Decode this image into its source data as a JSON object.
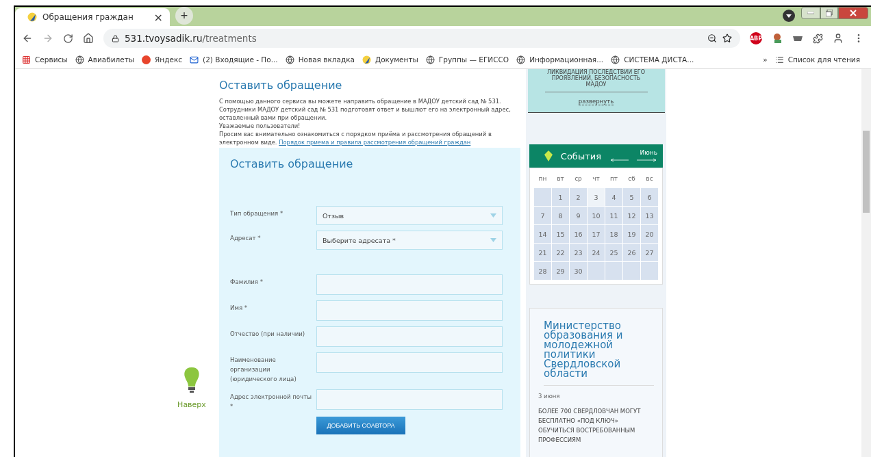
{
  "browser": {
    "tab_title": "Обращения граждан",
    "close": "×",
    "new_tab": "+",
    "url_host": "531.tvoysadik.ru",
    "url_path": "/treatments",
    "bookmarks": [
      {
        "label": "Сервисы",
        "kind": "apps"
      },
      {
        "label": "Авиабилеты",
        "kind": "globe"
      },
      {
        "label": "Яндекс",
        "kind": "yandex"
      },
      {
        "label": "(2) Входящие - По...",
        "kind": "mail"
      },
      {
        "label": "Новая вкладка",
        "kind": "globe"
      },
      {
        "label": "Документы",
        "kind": "logo"
      },
      {
        "label": "Группы — ЕГИССО",
        "kind": "globe"
      },
      {
        "label": "Информационная...",
        "kind": "globe"
      },
      {
        "label": "СИСТЕМА ДИСТА...",
        "kind": "globe"
      }
    ],
    "more": "»",
    "reading_list": "Список для чтения",
    "abp": "ABP"
  },
  "to_top": {
    "label": "Наверх"
  },
  "intro": {
    "title": "Оставить обращение",
    "lines": [
      "С помощью данного сервиса вы можете направить обращение в МАДОУ детский сад № 531. Сотрудники МАДОУ детский сад № 531 подготовят ответ и вышлют его на электронный адрес, оставленный вами при обращении.",
      "Уважаемые пользователи!",
      "Просим вас внимательно ознакомиться с порядком приёма и рассмотрения обращений в электронном виде."
    ],
    "link": "Порядок приема и правила рассмотрения обращений граждан"
  },
  "form": {
    "title": "Оставить обращение",
    "fields": [
      {
        "kind": "select",
        "label": "Тип обращения *",
        "value": "Отзыв"
      },
      {
        "kind": "select",
        "label": "Адресат *",
        "value": "Выберите адресата *"
      },
      {
        "kind": "text",
        "label": "Фамилия *"
      },
      {
        "kind": "text",
        "label": "Имя *"
      },
      {
        "kind": "text",
        "label": "Отчество (при наличии)"
      },
      {
        "kind": "text",
        "label": "Наименование организации (юридического лица)"
      },
      {
        "kind": "text",
        "label": "Адрес электронной почты *"
      }
    ],
    "button": "ДОБАВИТЬ СОАВТОРА"
  },
  "notice": {
    "text": "ЛИКВИДАЦИЯ ПОСЛЕДСТВИЙ ЕГО ПРОЯВЛЕНИЙ, БЕЗОПАСНОСТЬ МАДОУ",
    "link": "развернуть"
  },
  "calendar": {
    "title": "События",
    "month": "Июнь",
    "weekdays": [
      "пн",
      "вт",
      "ср",
      "чт",
      "пт",
      "сб",
      "вс"
    ],
    "weeks": [
      [
        {
          "today": false
        },
        {
          "day": "1",
          "today": false
        },
        {
          "day": "2",
          "today": false
        },
        {
          "day": "3",
          "today": true
        },
        {
          "day": "4",
          "today": false
        },
        {
          "day": "5",
          "today": false
        },
        {
          "day": "6",
          "today": false
        }
      ],
      [
        {
          "day": "7",
          "today": false
        },
        {
          "day": "8",
          "today": false
        },
        {
          "day": "9",
          "today": false
        },
        {
          "day": "10",
          "today": false
        },
        {
          "day": "11",
          "today": false
        },
        {
          "day": "12",
          "today": false
        },
        {
          "day": "13",
          "today": false
        }
      ],
      [
        {
          "day": "14",
          "today": false
        },
        {
          "day": "15",
          "today": false
        },
        {
          "day": "16",
          "today": false
        },
        {
          "day": "17",
          "today": false
        },
        {
          "day": "18",
          "today": false
        },
        {
          "day": "19",
          "today": false
        },
        {
          "day": "20",
          "today": false
        }
      ],
      [
        {
          "day": "21",
          "today": false
        },
        {
          "day": "22",
          "today": false
        },
        {
          "day": "23",
          "today": false
        },
        {
          "day": "24",
          "today": false
        },
        {
          "day": "25",
          "today": false
        },
        {
          "day": "26",
          "today": false
        },
        {
          "day": "27",
          "today": false
        }
      ],
      [
        {
          "day": "28",
          "today": false
        },
        {
          "day": "29",
          "today": false
        },
        {
          "day": "30",
          "today": false
        },
        {
          "today": false
        },
        {
          "today": false
        },
        {
          "today": false
        },
        {
          "today": false
        }
      ]
    ]
  },
  "news": {
    "title": "Министерство образования и молодежной политики Свердловской области",
    "date": "3 июня",
    "headline": "БОЛЕЕ 700 СВЕРДЛОВЧАН МОГУТ БЕСПЛАТНО «ПОД КЛЮЧ» ОБУЧИТЬСЯ ВОСТРЕБОВАННЫМ ПРОФЕССИЯМ"
  }
}
